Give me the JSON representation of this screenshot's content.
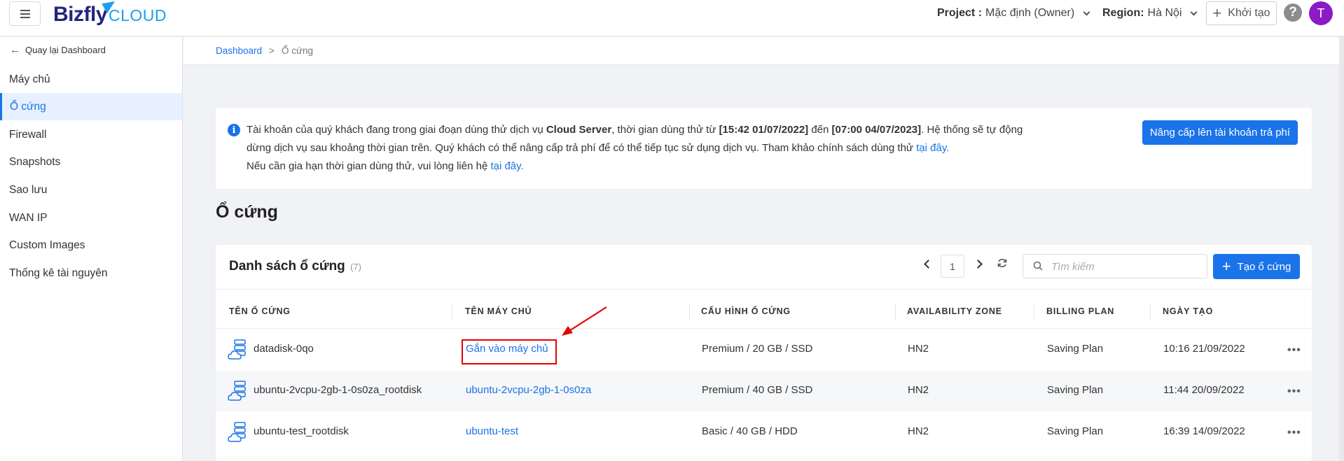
{
  "header": {
    "logo_main": "Bizfly",
    "logo_sub": "CLOUD",
    "project_label": "Project :",
    "project_value": "Mặc định (Owner)",
    "region_label": "Region:",
    "region_value": "Hà Nội",
    "create_label": "Khởi tạo",
    "help_symbol": "?",
    "avatar_initial": "T"
  },
  "sidebar": {
    "back_label": "Quay lại Dashboard",
    "items": [
      {
        "label": "Máy chủ"
      },
      {
        "label": "Ổ cứng"
      },
      {
        "label": "Firewall"
      },
      {
        "label": "Snapshots"
      },
      {
        "label": "Sao lưu"
      },
      {
        "label": "WAN IP"
      },
      {
        "label": "Custom Images"
      },
      {
        "label": "Thống kê tài nguyên"
      }
    ]
  },
  "breadcrumb": {
    "root": "Dashboard",
    "separator": ">",
    "current": "Ổ cứng"
  },
  "notice": {
    "line1_a": "Tài khoản của quý khách đang trong giai đoạn dùng thử dịch vụ ",
    "service": "Cloud Server",
    "line1_b": ", thời gian dùng thử từ ",
    "start": "[15:42 01/07/2022]",
    "line1_c": " đến ",
    "end": "[07:00 04/07/2023]",
    "line1_d": ". Hệ thống sẽ tự động",
    "line2": "dừng dịch vụ sau khoảng thời gian trên. Quý khách có thể nâng cấp trả phí để có thể tiếp tục sử dụng dịch vụ. Tham khảo chính sách dùng thử ",
    "link1": "tại đây.",
    "line3": "Nếu cần gia hạn thời gian dùng thử, vui lòng liên hệ ",
    "link2": "tại đây.",
    "upgrade_label": "Nâng cấp lên tài khoản trả phí"
  },
  "page_title": "Ổ cứng",
  "disk_list": {
    "title": "Danh sách ổ cứng",
    "count": "(7)",
    "page": "1",
    "search_placeholder": "Tìm kiếm",
    "create_label": "Tạo ổ cứng",
    "columns": [
      "Tên ổ cứng",
      "Tên máy chủ",
      "Cấu hình ổ cứng",
      "Availability zone",
      "Billing plan",
      "Ngày tạo"
    ],
    "rows": [
      {
        "name": "datadisk-0qo",
        "server": "Gắn vào máy chủ",
        "config": "Premium / 20 GB / SSD",
        "zone": "HN2",
        "billing": "Saving Plan",
        "created": "10:16 21/09/2022"
      },
      {
        "name": "ubuntu-2vcpu-2gb-1-0s0za_rootdisk",
        "server": "ubuntu-2vcpu-2gb-1-0s0za",
        "config": "Premium / 40 GB / SSD",
        "zone": "HN2",
        "billing": "Saving Plan",
        "created": "11:44 20/09/2022"
      },
      {
        "name": "ubuntu-test_rootdisk",
        "server": "ubuntu-test",
        "config": "Basic / 40 GB / HDD",
        "zone": "HN2",
        "billing": "Saving Plan",
        "created": "16:39 14/09/2022"
      }
    ],
    "more_symbol": "•••"
  },
  "colors": {
    "primary": "#1a73e8",
    "brand_dark": "#23257d",
    "brand_light": "#1e9df1",
    "avatar": "#8b1bc4",
    "annotation": "#e60000"
  }
}
